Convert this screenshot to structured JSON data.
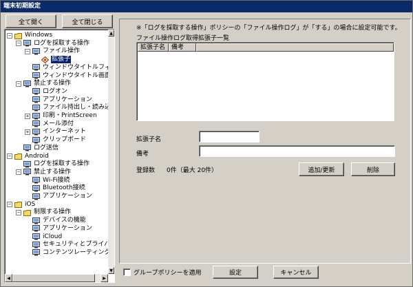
{
  "window": {
    "title": "端末初期設定"
  },
  "toolbar": {
    "expand_all": "全て開く",
    "collapse_all": "全て閉じる"
  },
  "tree": {
    "nodes": [
      {
        "label": "Windows",
        "expander": "−",
        "icon": "folder-icon"
      },
      {
        "label": "ログを採取する操作",
        "expander": "−",
        "icon": "monitor-icon"
      },
      {
        "label": "ファイル操作",
        "expander": "−",
        "icon": "monitor-icon"
      },
      {
        "label": "拡張子",
        "expander": "",
        "icon": "diamond-icon",
        "selected": true
      },
      {
        "label": "ウィンドウタイトルフィルタ",
        "expander": "",
        "icon": "monitor-icon"
      },
      {
        "label": "ウィンドウタイトル画面キャ",
        "expander": "",
        "icon": "monitor-icon"
      },
      {
        "label": "禁止する操作",
        "expander": "−",
        "icon": "monitor-icon"
      },
      {
        "label": "ログオン",
        "expander": "",
        "icon": "monitor-icon"
      },
      {
        "label": "アプリケーション",
        "expander": "",
        "icon": "monitor-icon"
      },
      {
        "label": "ファイル持出し・読み込み",
        "expander": "",
        "icon": "monitor-icon"
      },
      {
        "label": "印刷・PrintScreen",
        "expander": "+",
        "icon": "monitor-icon"
      },
      {
        "label": "メール添付",
        "expander": "",
        "icon": "monitor-icon"
      },
      {
        "label": "インターネット",
        "expander": "+",
        "icon": "monitor-icon"
      },
      {
        "label": "クリップボード",
        "expander": "",
        "icon": "monitor-icon"
      },
      {
        "label": "ログ送信",
        "expander": "",
        "icon": "monitor-icon"
      },
      {
        "label": "Android",
        "expander": "−",
        "icon": "folder-icon"
      },
      {
        "label": "ログを採取する操作",
        "expander": "",
        "icon": "monitor-icon"
      },
      {
        "label": "禁止する操作",
        "expander": "−",
        "icon": "monitor-icon"
      },
      {
        "label": "Wi-Fi接続",
        "expander": "",
        "icon": "monitor-icon"
      },
      {
        "label": "Bluetooth接続",
        "expander": "",
        "icon": "monitor-icon"
      },
      {
        "label": "アプリケーション",
        "expander": "",
        "icon": "monitor-icon"
      },
      {
        "label": "iOS",
        "expander": "−",
        "icon": "folder-icon"
      },
      {
        "label": "制限する操作",
        "expander": "−",
        "icon": "folder-icon"
      },
      {
        "label": "デバイスの機能",
        "expander": "",
        "icon": "monitor-icon"
      },
      {
        "label": "アプリケーション",
        "expander": "",
        "icon": "monitor-icon"
      },
      {
        "label": "iCloud",
        "expander": "",
        "icon": "monitor-icon"
      },
      {
        "label": "セキュリティとプライバシー",
        "expander": "",
        "icon": "monitor-icon"
      },
      {
        "label": "コンテンツレーティング",
        "expander": "",
        "icon": "monitor-icon"
      }
    ]
  },
  "panel": {
    "note": "※「ログを採取する操作」ポリシーの「ファイル操作ログ」が「する」の場合に設定可能です。",
    "list_label": "ファイル操作ログ取得拡張子一覧",
    "columns": [
      "拡張子名",
      "備考"
    ],
    "ext_label": "拡張子名",
    "ext_value": "",
    "memo_label": "備考",
    "memo_value": "",
    "count_label": "登録数",
    "count_value": "0件（最大 20件）",
    "add_button": "追加/更新",
    "delete_button": "削除"
  },
  "footer": {
    "group_policy_label": "グループポリシーを適用",
    "group_policy_checked": false,
    "ok_button": "設定",
    "cancel_button": "キャンセル"
  },
  "colors": {
    "titlebar": "#0a2a6a",
    "face": "#d4d0c8",
    "selection": "#0a246a",
    "folder": "#f5d76e"
  }
}
